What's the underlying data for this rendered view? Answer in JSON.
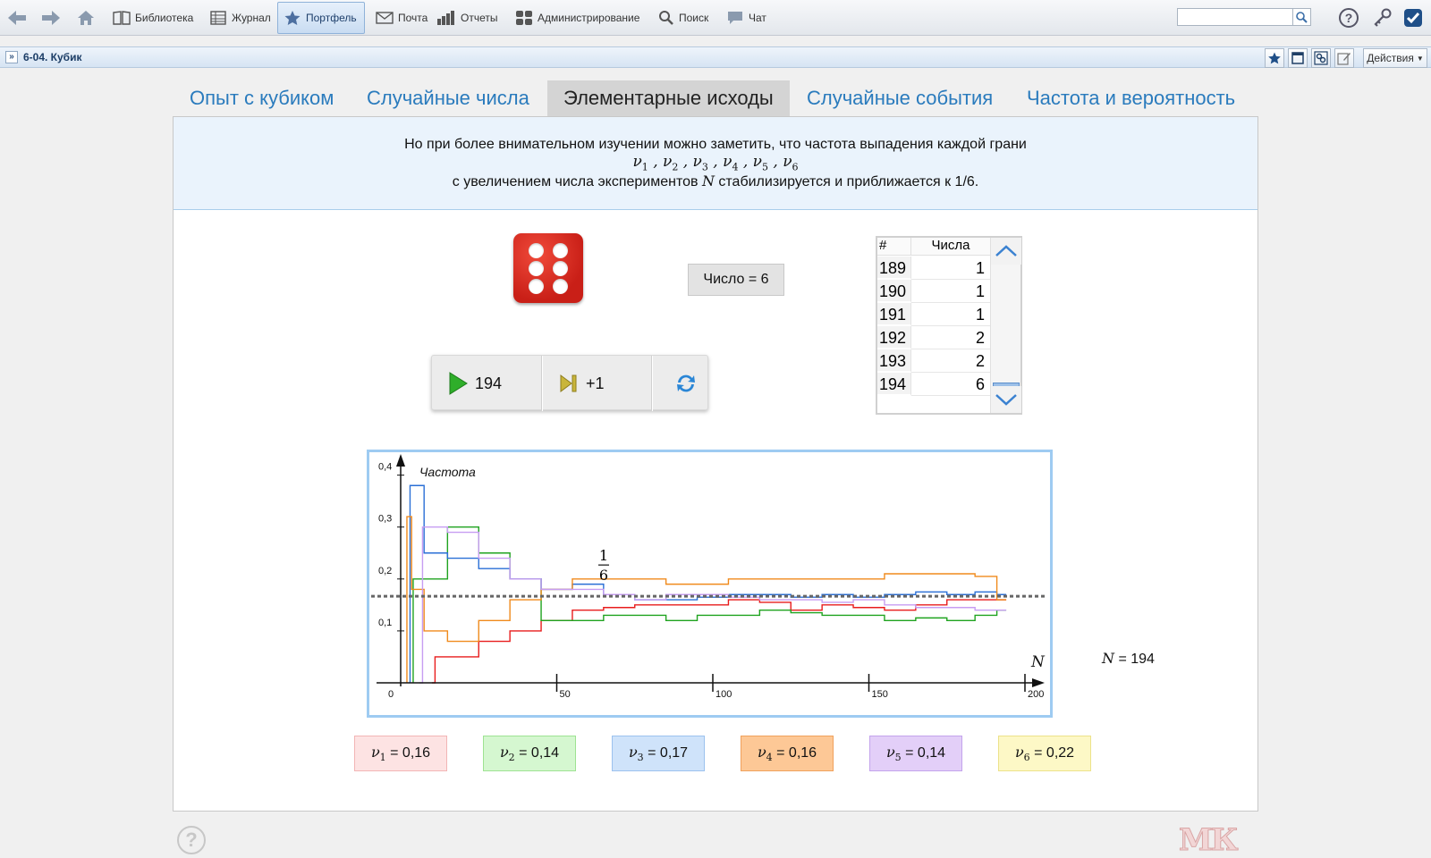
{
  "toolbar": {
    "items": [
      {
        "label": "Библиотека",
        "icon": "book-icon"
      },
      {
        "label": "Журнал",
        "icon": "journal-icon"
      },
      {
        "label": "Портфель",
        "icon": "star-icon",
        "active": true
      },
      {
        "label": "Почта",
        "icon": "mail-icon"
      },
      {
        "label": "Отчеты",
        "icon": "reports-icon"
      },
      {
        "label": "Администрирование",
        "icon": "admin-icon"
      },
      {
        "label": "Поиск",
        "icon": "search-icon"
      },
      {
        "label": "Чат",
        "icon": "chat-icon"
      }
    ],
    "search_value": ""
  },
  "subbar": {
    "title": "6-04. Кубик",
    "actions_label": "Действия"
  },
  "tabs": [
    {
      "label": "Опыт с кубиком"
    },
    {
      "label": "Случайные числа"
    },
    {
      "label": "Элементарные исходы",
      "active": true
    },
    {
      "label": "Случайные события"
    },
    {
      "label": "Частота и вероятность"
    }
  ],
  "info": {
    "line1": "Но при более внимательном изучении можно заметить, что частота выпадения каждой грани",
    "line3_prefix": "с увеличением числа экспериментов",
    "line3_var": "N",
    "line3_suffix": "стабилизируется и приближается к 1/6."
  },
  "die": {
    "face": 6,
    "color": "#d9261c"
  },
  "number_display": "Число = 6",
  "controls": {
    "run_label": "194",
    "step_label": "+1"
  },
  "table": {
    "col_index": "#",
    "col_values": "Числа",
    "rows": [
      {
        "n": "189",
        "v": "1"
      },
      {
        "n": "190",
        "v": "1"
      },
      {
        "n": "191",
        "v": "1"
      },
      {
        "n": "192",
        "v": "2"
      },
      {
        "n": "193",
        "v": "2"
      },
      {
        "n": "194",
        "v": "6"
      }
    ]
  },
  "n_readout": {
    "var": "N",
    "value": "= 194"
  },
  "frequencies": [
    {
      "sub": "1",
      "text": "= 0,16",
      "bg": "#fde3e3",
      "border": "#f2b5b5"
    },
    {
      "sub": "2",
      "text": "= 0,14",
      "bg": "#d5f7d0",
      "border": "#9ee392"
    },
    {
      "sub": "3",
      "text": "= 0,17",
      "bg": "#cfe3fa",
      "border": "#9cc2ee"
    },
    {
      "sub": "4",
      "text": "= 0,16",
      "bg": "#fdc896",
      "border": "#f0a15c"
    },
    {
      "sub": "5",
      "text": "= 0,14",
      "bg": "#e3cff8",
      "border": "#c3a3ec"
    },
    {
      "sub": "6",
      "text": "= 0,22",
      "bg": "#fdf8c6",
      "border": "#ece28a"
    }
  ],
  "chart_data": {
    "type": "line",
    "ylabel": "Частота",
    "xlabel": "N",
    "xticks": [
      "0",
      "50",
      "100",
      "150",
      "200"
    ],
    "yticks": [
      "0,1",
      "0,2",
      "0,3",
      "0,4"
    ],
    "xlim": [
      0,
      200
    ],
    "ylim": [
      0,
      0.42
    ],
    "reference_line": {
      "y": 0.1667,
      "label_num": "1",
      "label_den": "6"
    },
    "series": [
      {
        "color": "#e81c1c",
        "x": [
          10,
          12,
          20,
          30,
          40,
          50,
          60,
          70,
          80,
          90,
          100,
          110,
          120,
          130,
          140,
          150,
          160,
          170,
          180,
          188,
          194
        ],
        "y": [
          0,
          0.05,
          0.05,
          0.08,
          0.1,
          0.12,
          0.14,
          0.145,
          0.15,
          0.15,
          0.15,
          0.16,
          0.155,
          0.14,
          0.15,
          0.145,
          0.14,
          0.15,
          0.16,
          0.16,
          0.16
        ]
      },
      {
        "color": "#1fa31f",
        "x": [
          4,
          5,
          10,
          20,
          30,
          40,
          50,
          60,
          70,
          80,
          90,
          100,
          110,
          120,
          130,
          140,
          150,
          160,
          170,
          180,
          188,
          194
        ],
        "y": [
          0.2,
          0.2,
          0.2,
          0.3,
          0.25,
          0.2,
          0.12,
          0.12,
          0.13,
          0.13,
          0.12,
          0.13,
          0.13,
          0.14,
          0.135,
          0.13,
          0.13,
          0.12,
          0.125,
          0.12,
          0.13,
          0.14
        ]
      },
      {
        "color": "#2a6fd6",
        "x": [
          3,
          5,
          10,
          20,
          30,
          40,
          50,
          60,
          70,
          80,
          90,
          100,
          110,
          120,
          130,
          140,
          150,
          160,
          170,
          180,
          188,
          194
        ],
        "y": [
          0.38,
          0.38,
          0.25,
          0.24,
          0.22,
          0.2,
          0.18,
          0.19,
          0.17,
          0.16,
          0.16,
          0.165,
          0.17,
          0.17,
          0.165,
          0.17,
          0.165,
          0.17,
          0.175,
          0.17,
          0.175,
          0.17
        ]
      },
      {
        "color": "#f08a1c",
        "x": [
          2,
          5,
          10,
          20,
          30,
          40,
          50,
          60,
          70,
          80,
          90,
          100,
          110,
          120,
          130,
          140,
          150,
          160,
          170,
          180,
          188,
          194
        ],
        "y": [
          0.32,
          0.18,
          0.1,
          0.08,
          0.12,
          0.16,
          0.18,
          0.2,
          0.2,
          0.2,
          0.19,
          0.19,
          0.2,
          0.2,
          0.2,
          0.2,
          0.2,
          0.21,
          0.21,
          0.21,
          0.205,
          0.16
        ]
      },
      {
        "color": "#c79df2",
        "x": [
          6,
          8,
          10,
          20,
          30,
          40,
          50,
          60,
          70,
          80,
          90,
          100,
          110,
          120,
          130,
          140,
          150,
          160,
          170,
          180,
          188,
          194
        ],
        "y": [
          0,
          0.3,
          0.3,
          0.29,
          0.24,
          0.2,
          0.18,
          0.18,
          0.17,
          0.16,
          0.17,
          0.17,
          0.165,
          0.16,
          0.16,
          0.155,
          0.16,
          0.15,
          0.145,
          0.145,
          0.14,
          0.14
        ]
      }
    ]
  }
}
